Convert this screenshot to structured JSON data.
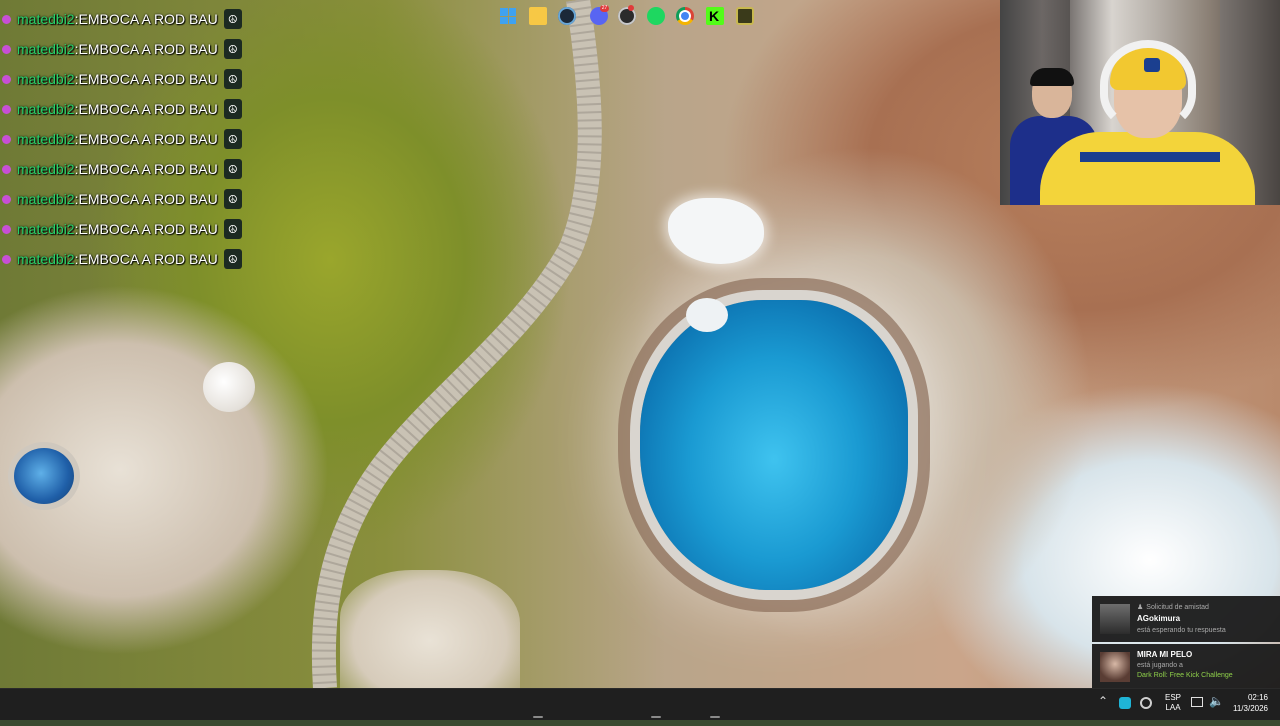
{
  "chat": {
    "messages": [
      {
        "user": "matedbi2",
        "text": "EMBOCA A ROD BAU"
      },
      {
        "user": "matedbi2",
        "text": "EMBOCA A ROD BAU"
      },
      {
        "user": "matedbi2",
        "text": "EMBOCA A ROD BAU"
      },
      {
        "user": "matedbi2",
        "text": "EMBOCA A ROD BAU"
      },
      {
        "user": "matedbi2",
        "text": "EMBOCA A ROD BAU"
      },
      {
        "user": "matedbi2",
        "text": "EMBOCA A ROD BAU"
      },
      {
        "user": "matedbi2",
        "text": "EMBOCA A ROD BAU"
      },
      {
        "user": "matedbi2",
        "text": "EMBOCA A ROD BAU"
      },
      {
        "user": "matedbi2",
        "text": "EMBOCA A ROD BAU"
      }
    ],
    "separator": ": ",
    "name_color": "#27d26a"
  },
  "notifications": {
    "friend_request": {
      "kicker": "Solicitud de amistad",
      "name": "AGokimura",
      "status": "está esperando tu respuesta"
    },
    "now_playing": {
      "name": "MIRA MI PELO",
      "status": "está jugando a",
      "game": "Dark Roll: Free Kick Challenge"
    }
  },
  "taskbar": {
    "apps": [
      "windows-start",
      "file-explorer",
      "steam",
      "discord",
      "obs",
      "spotify",
      "chrome",
      "kick",
      "app"
    ],
    "discord_badge": "27",
    "tray": {
      "lang_line1": "ESP",
      "lang_line2": "LAA",
      "time": "02:16",
      "date": "11/3/2026"
    }
  },
  "colors": {
    "accent": "#3fa2f0",
    "kick_green": "#53fc18",
    "game_green": "#8fd14a"
  }
}
